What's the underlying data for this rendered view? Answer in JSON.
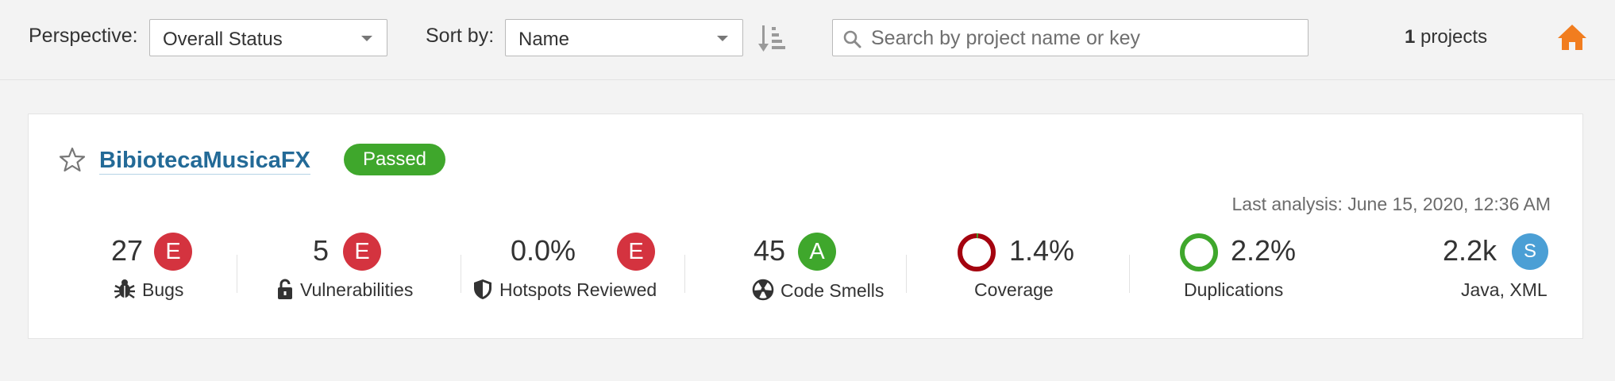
{
  "topbar": {
    "perspective_label": "Perspective:",
    "perspective_value": "Overall Status",
    "sort_label": "Sort by:",
    "sort_value": "Name",
    "search_placeholder": "Search by project name or key",
    "count_number": "1",
    "count_text": " projects",
    "icons": {
      "sort": "sort-descending-icon",
      "search": "search-icon",
      "home": "home-icon"
    },
    "home_color": "#f17d1f"
  },
  "project": {
    "name": "BibiotecaMusicaFX",
    "quality_gate": "Passed",
    "last_analysis": "Last analysis: June 15, 2020, 12:36 AM",
    "measures": {
      "bugs": {
        "value": "27",
        "rating": "E",
        "label": "Bugs",
        "icon": "bug-icon"
      },
      "vulnerabilities": {
        "value": "5",
        "rating": "E",
        "label": "Vulnerabilities",
        "icon": "unlock-icon"
      },
      "hotspots": {
        "value": "0.0%",
        "rating": "E",
        "label": "Hotspots Reviewed",
        "icon": "shield-icon"
      },
      "code_smells": {
        "value": "45",
        "rating": "A",
        "label": "Code Smells",
        "icon": "radiation-icon"
      },
      "coverage": {
        "value": "1.4%",
        "label": "Coverage",
        "percent": 1.4
      },
      "duplications": {
        "value": "2.2%",
        "label": "Duplications",
        "percent": 2.2
      },
      "size": {
        "value": "2.2k",
        "rating": "S",
        "label": "Java, XML"
      }
    }
  },
  "colors": {
    "rating_E": "#d4333f",
    "rating_A": "#3fa72c",
    "size_badge": "#4b9fd5",
    "passed": "#3fa72c",
    "link": "#236a97",
    "coverage_ring": "#a4030f",
    "duplications_ring": "#3fa72c"
  }
}
